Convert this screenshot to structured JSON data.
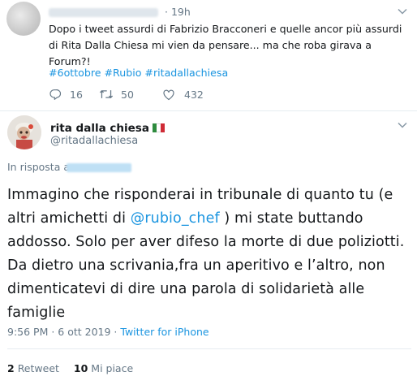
{
  "parent_tweet": {
    "time": "19h",
    "text": "Dopo i tweet assurdi di Fabrizio Bracconeri e quelle ancor più assurdi di Rita Dalla Chiesa mi vien da pensare... ma che roba girava a Forum?!",
    "hashtags": "#6ottobre #Rubio #ritadallachiesa",
    "reply_count": "16",
    "retweet_count": "50",
    "like_count": "432",
    "icons": {
      "reply": "reply-icon",
      "retweet": "retweet-icon",
      "like": "heart-icon"
    }
  },
  "main_tweet": {
    "author_name": "rita dalla chiesa",
    "author_handle": "@ritadallachiesa",
    "flag": "italy-flag",
    "reply_prefix": "In risposta a",
    "text_before": "Immagino che risponderai in tribunale di quanto tu (e altri amichetti di ",
    "mention": "@rubio_chef",
    "text_after": " ) mi state buttando addosso. Solo per aver difeso la morte di due poliziotti. Da dietro una scrivania,fra un aperitivo e l’altro, non dimenticatevi di dire una parola di solidarietà alle famiglie",
    "timestamp": "9:56 PM · 6 ott 2019",
    "meta_separator": " · ",
    "source": "Twitter for iPhone",
    "retweets": "2",
    "retweets_label": "Retweet",
    "likes": "10",
    "likes_label": "Mi piace"
  },
  "colors": {
    "accent": "#1b95e0",
    "muted": "#657786",
    "border": "#e6ecf0"
  }
}
